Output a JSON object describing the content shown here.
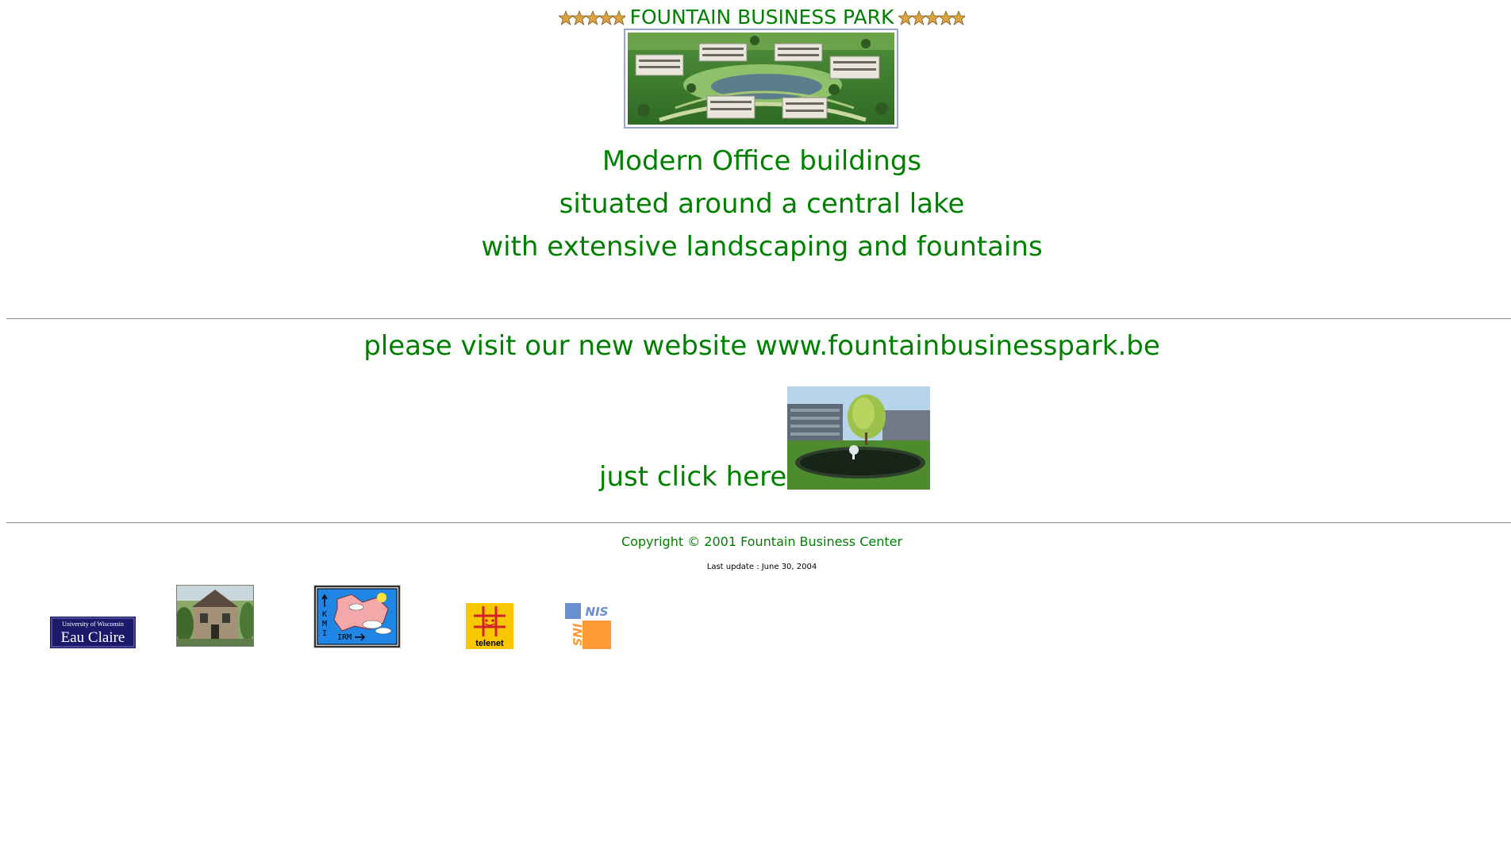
{
  "header": {
    "title": "FOUNTAIN BUSINESS PARK",
    "star_color": "#d9a441"
  },
  "taglines": [
    "Modern Office buildings",
    "situated around a central lake",
    "with extensive landscaping and fountains"
  ],
  "visit": {
    "text": "please visit our new website www.fountainbusinesspark.be"
  },
  "click": {
    "label": "just click here"
  },
  "footer": {
    "copyright": "Copyright © 2001 Fountain Business Center",
    "last_update": "Last update : June 30, 2004"
  },
  "logos": {
    "uwec_line1": "University of Wisconsin",
    "uwec_line2": "Eau Claire",
    "kmi_letters": [
      "K",
      "M",
      "I"
    ],
    "kmi_irm": "IRM",
    "telenet": "telenet",
    "nis_top": "NIS",
    "nis_side": "INS"
  },
  "colors": {
    "text_green": "#008000",
    "uwec_blue": "#1b1a6b",
    "kmi_blue": "#1f86e6",
    "telenet_yellow": "#f7c800",
    "nis_orange": "#ff9933",
    "nis_blue": "#6b8fd0"
  }
}
